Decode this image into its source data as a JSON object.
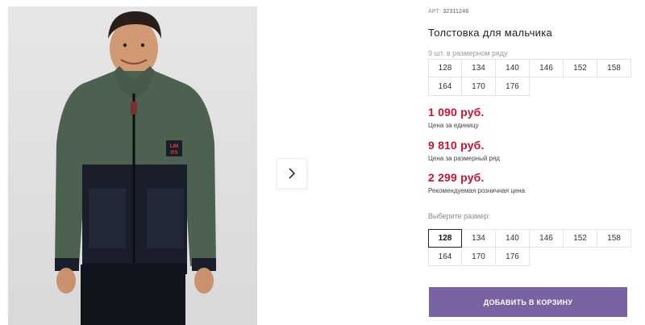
{
  "product": {
    "article_label": "АРТ:",
    "article_number": "32311246",
    "title": "Толстовка для мальчика",
    "pack_note": "9 шт. в размерном ряду",
    "pack_sizes": [
      "128",
      "134",
      "140",
      "146",
      "152",
      "158",
      "164",
      "170",
      "176"
    ],
    "prices": [
      {
        "value": "1 090 руб.",
        "label": "Цена за единицу"
      },
      {
        "value": "9 810 руб.",
        "label": "Цена за размерный ряд"
      },
      {
        "value": "2 299 руб.",
        "label": "Рекомендуемая розничная цена"
      }
    ],
    "choose_size_label": "Выберите размер:",
    "sizes": [
      "128",
      "134",
      "140",
      "146",
      "152",
      "158",
      "164",
      "170",
      "176"
    ],
    "selected_size": "128",
    "add_to_cart_label": "ДОБАВИТЬ В КОРЗИНУ",
    "patch_text_top": "LIM",
    "patch_text_bottom": "ITS"
  },
  "gallery": {
    "next_icon": "chevron-right-icon"
  },
  "colors": {
    "price": "#d0122f",
    "button": "#7a63a3",
    "fleece_green": "#4d6150",
    "navy": "#1a1e2b"
  }
}
